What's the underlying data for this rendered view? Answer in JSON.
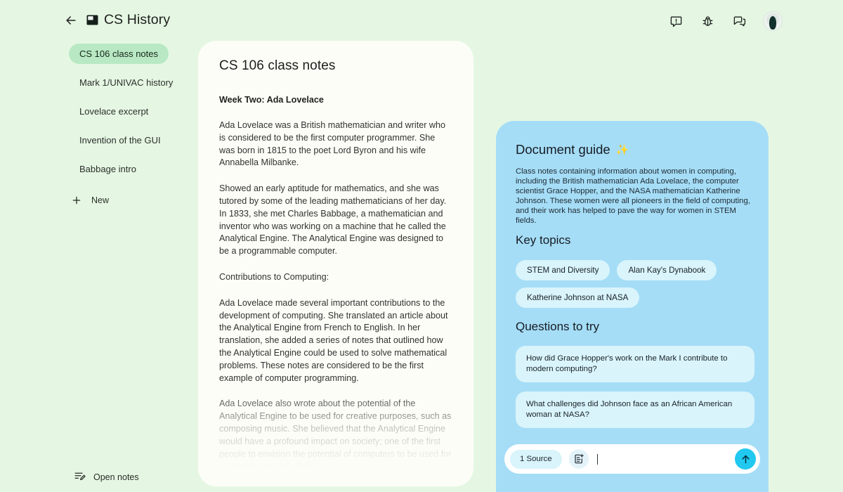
{
  "header": {
    "back_icon": "arrow-left-icon",
    "app_mark_icon": "notebook-mark-icon",
    "title": "CS History",
    "actions": [
      {
        "name": "feedback-icon",
        "label": "Feedback"
      },
      {
        "name": "bug-report-icon",
        "label": "Report a bug"
      },
      {
        "name": "chat-icon",
        "label": "Chat"
      }
    ],
    "avatar_label": "Account"
  },
  "sidebar": {
    "items": [
      {
        "label": "CS 106 class notes",
        "active": true
      },
      {
        "label": "Mark 1/UNIVAC history",
        "active": false
      },
      {
        "label": "Lovelace excerpt",
        "active": false
      },
      {
        "label": "Invention of the GUI",
        "active": false
      },
      {
        "label": "Babbage intro",
        "active": false
      }
    ],
    "new_label": "New",
    "new_icon": "plus-icon",
    "open_notes_label": "Open notes",
    "open_notes_icon": "edit-note-icon"
  },
  "document": {
    "title": "CS 106 class notes",
    "heading": "Week Two: Ada Lovelace",
    "paragraphs": [
      "Ada Lovelace was a British mathematician and writer who is considered to be the first computer programmer. She was born in 1815 to the poet Lord Byron and his wife Annabella Milbanke.",
      "Showed an early aptitude for mathematics, and she was tutored by some of the leading mathematicians of her day. In 1833, she met Charles Babbage, a mathematician and inventor who was working on a machine that he called the Analytical Engine. The Analytical Engine was designed to be a programmable computer.",
      "Contributions to Computing:",
      "Ada Lovelace made several important contributions to the development of computing. She translated an article about the Analytical Engine from French to English. In her translation, she added a series of notes that outlined how the Analytical Engine could be used to solve mathematical problems. These notes are considered to be the first example of computer programming.",
      "Ada Lovelace also wrote about the potential of the Analytical Engine to be used for creative purposes, such as composing music. She believed that the Analytical Engine would have a profound impact on society; one of the first people to envision the potential of computers to be used for more than just calculation."
    ]
  },
  "guide": {
    "title": "Document guide",
    "title_icon": "sparkles-icon",
    "sparkle_glyph": "✨",
    "description": "Class notes containing information about women in computing, including the British mathematician Ada Lovelace, the computer scientist Grace Hopper, and the NASA mathematician Katherine Johnson. These women were all pioneers in the field of computing, and their work has helped to pave the way for women in STEM fields.",
    "key_topics_title": "Key topics",
    "key_topics": [
      "STEM and Diversity",
      "Alan Kay's Dynabook",
      "Katherine Johnson at NASA"
    ],
    "questions_title": "Questions to try",
    "questions": [
      "How did Grace Hopper's work on the Mark I contribute to modern computing?",
      "What challenges did Johnson face as an African American woman at NASA?"
    ]
  },
  "composer": {
    "source_chip": "1 Source",
    "add_note_icon": "add-note-icon",
    "input_value": "",
    "input_placeholder": "",
    "send_icon": "arrow-up-icon"
  },
  "colors": {
    "background": "#e5f7e3",
    "sidebar_active": "#b9e9c4",
    "document_card": "#fdfdf7",
    "guide_panel": "#a5ddf7",
    "chip": "#d9f4fb",
    "send_button": "#21c8ef",
    "text": "#1c1b1f"
  }
}
